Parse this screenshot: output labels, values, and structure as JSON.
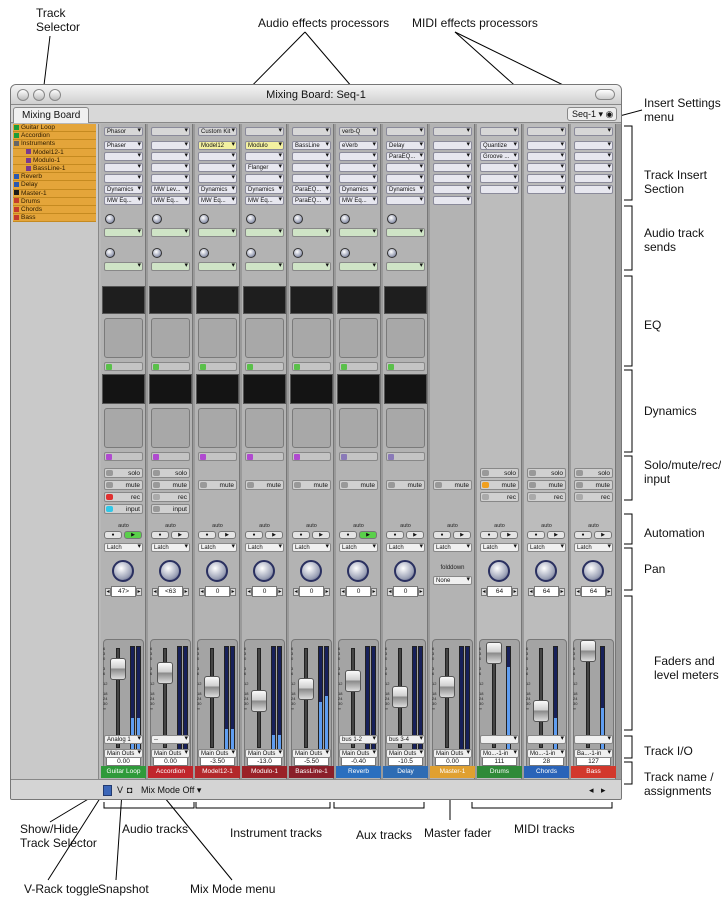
{
  "window": {
    "title": "Mixing Board: Seq-1",
    "tab": "Mixing Board",
    "seq_menu": "Seq-1"
  },
  "track_selector": [
    {
      "label": "Guitar Loop",
      "icon": "audio"
    },
    {
      "label": "Accordion",
      "icon": "audio"
    },
    {
      "label": "Instruments",
      "icon": "folder"
    },
    {
      "label": "Model12-1",
      "icon": "instrument"
    },
    {
      "label": "Modulo-1",
      "icon": "instrument"
    },
    {
      "label": "BassLine-1",
      "icon": "instrument"
    },
    {
      "label": "Reverb",
      "icon": "aux"
    },
    {
      "label": "Delay",
      "icon": "aux"
    },
    {
      "label": "Master-1",
      "icon": "master"
    },
    {
      "label": "Drums",
      "icon": "midi"
    },
    {
      "label": "Chords",
      "icon": "midi"
    },
    {
      "label": "Bass",
      "icon": "midi"
    }
  ],
  "strips": [
    {
      "name": "Guitar Loop",
      "color": "#2f9a3a",
      "kind": "audio",
      "top": "Phasor",
      "inserts": [
        "Phaser",
        "",
        "",
        "",
        "Dynamics",
        "MW Eq..."
      ],
      "pan": "47>",
      "fader": "0.00",
      "input": "Analog 1",
      "output": "Main Outs",
      "smr": [
        "solo",
        "mute",
        "rec",
        "input"
      ],
      "mode": "Latch"
    },
    {
      "name": "Accordion",
      "color": "#c0262c",
      "kind": "audio",
      "top": "",
      "inserts": [
        "",
        "",
        "",
        "",
        "MW Lev...",
        "MW Eq..."
      ],
      "pan": "<63",
      "fader": "0.00",
      "input": "--",
      "output": "Main Outs",
      "smr": [
        "solo",
        "mute",
        "rec",
        "input"
      ],
      "mode": "Latch"
    },
    {
      "name": "Model12-1",
      "color": "#b3282b",
      "kind": "inst",
      "top": "Custom Kit",
      "inserts": [
        "Model12",
        "",
        "",
        "",
        "Dynamics",
        "MW Eq..."
      ],
      "pan": "0",
      "fader": "-3.50",
      "input": "",
      "output": "Main Outs",
      "smr": [
        "mute"
      ],
      "mode": "Latch"
    },
    {
      "name": "Modulo-1",
      "color": "#9a2127",
      "kind": "inst",
      "top": "",
      "inserts": [
        "Modulo",
        "",
        "Flanger",
        "",
        "Dynamics",
        "MW Eq..."
      ],
      "pan": "0",
      "fader": "-13.0",
      "input": "",
      "output": "Main Outs",
      "smr": [
        "mute"
      ],
      "mode": "Latch"
    },
    {
      "name": "BassLine-1",
      "color": "#8a1f2a",
      "kind": "inst",
      "top": "",
      "inserts": [
        "BassLine",
        "",
        "",
        "",
        "ParaEQ...",
        "ParaEQ..."
      ],
      "pan": "0",
      "fader": "-5.50",
      "input": "",
      "output": "Main Outs",
      "smr": [
        "mute"
      ],
      "mode": "Latch"
    },
    {
      "name": "Reverb",
      "color": "#2a6fbf",
      "kind": "aux",
      "top": "verb-Q",
      "inserts": [
        "eVerb",
        "",
        "",
        "",
        "Dynamics",
        "MW Eq..."
      ],
      "pan": "0",
      "fader": "-0.40",
      "input": "bus 1-2",
      "output": "Main Outs",
      "smr": [
        "mute"
      ],
      "mode": "Latch"
    },
    {
      "name": "Delay",
      "color": "#2e6cb4",
      "kind": "aux",
      "top": "",
      "inserts": [
        "Delay",
        "ParaEQ...",
        "",
        "",
        "Dynamics",
        ""
      ],
      "pan": "0",
      "fader": "-10.5",
      "input": "bus 3-4",
      "output": "Main Outs",
      "smr": [
        "mute"
      ],
      "mode": "Latch"
    },
    {
      "name": "Master-1",
      "color": "#e0a030",
      "kind": "master",
      "top": "",
      "inserts": [
        "",
        "",
        "",
        "",
        "",
        ""
      ],
      "pan": "",
      "fader": "0.00",
      "input": "",
      "output": "Main Outs",
      "smr": [
        "mute"
      ],
      "mode": "Latch",
      "folddown": "folddown",
      "folddown_value": "None"
    },
    {
      "name": "Drums",
      "color": "#2f8a38",
      "kind": "midi",
      "top": "",
      "inserts": [
        "Quantize",
        "Groove ...",
        "",
        "",
        ""
      ],
      "pan": "64",
      "fader": "111",
      "input": "",
      "output": "Mo...-1-in",
      "smr": [
        "solo",
        "mute",
        "rec"
      ],
      "mode": "Latch"
    },
    {
      "name": "Chords",
      "color": "#2a63b8",
      "kind": "midi",
      "top": "",
      "inserts": [
        "",
        "",
        "",
        "",
        ""
      ],
      "pan": "64",
      "fader": "28",
      "input": "",
      "output": "Mo...-1-in",
      "smr": [
        "solo",
        "mute",
        "rec"
      ],
      "mode": "Latch"
    },
    {
      "name": "Bass",
      "color": "#d2382c",
      "kind": "midi",
      "top": "",
      "inserts": [
        "",
        "",
        "",
        "",
        ""
      ],
      "pan": "64",
      "fader": "127",
      "input": "",
      "output": "Ba...-1-in",
      "smr": [
        "solo",
        "mute",
        "rec"
      ],
      "mode": "Latch"
    }
  ],
  "automation_label": "auto",
  "bottom": {
    "v_label": "V",
    "mix_mode": "Mix Mode Off"
  },
  "callouts": {
    "track_selector": "Track\nSelector",
    "audio_fx": "Audio effects processors",
    "midi_fx": "MIDI effects processors",
    "insert_settings": "Insert Settings\nmenu",
    "track_insert": "Track Insert\nSection",
    "audio_sends": "Audio track\nsends",
    "eq": "EQ",
    "dynamics": "Dynamics",
    "solo": "Solo/mute/rec/\ninput",
    "automation": "Automation",
    "pan": "Pan",
    "faders": "Faders and\nlevel meters",
    "track_io": "Track I/O",
    "track_name": "Track name /\nassignments",
    "show_hide": "Show/Hide\nTrack Selector",
    "audio_tracks": "Audio tracks",
    "instrument_tracks": "Instrument tracks",
    "aux_tracks": "Aux tracks",
    "master_fader": "Master fader",
    "midi_tracks": "MIDI tracks",
    "vrack": "V-Rack toggle",
    "snapshot": "Snapshot",
    "mixmode_menu": "Mix Mode menu"
  }
}
